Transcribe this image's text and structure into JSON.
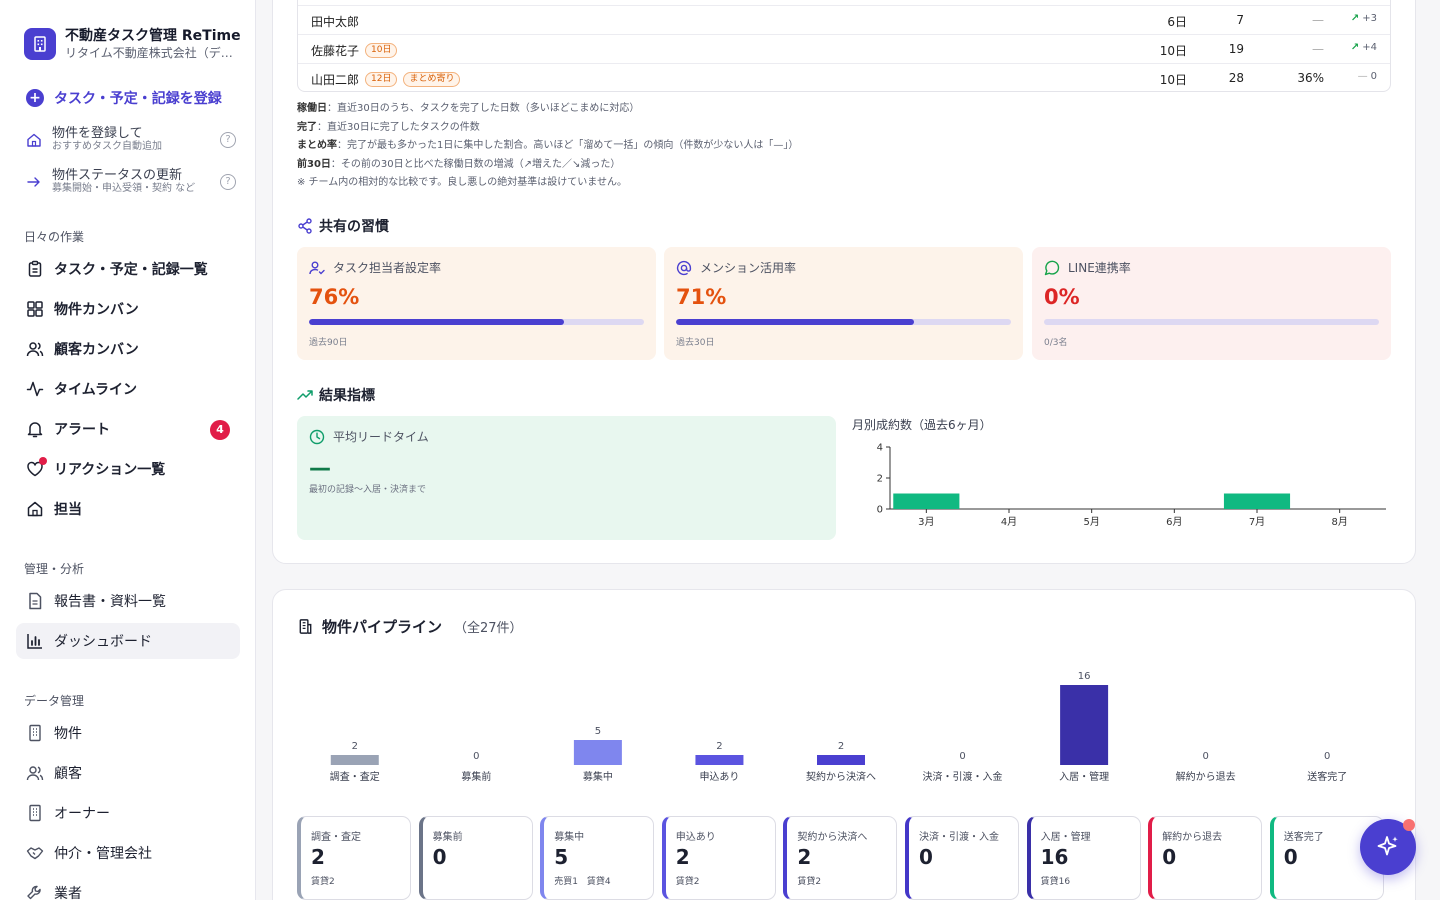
{
  "brand": {
    "title": "不動産タスク管理 ReTime",
    "subtitle": "リタイム不動産株式会社（デ…"
  },
  "sidebar": {
    "cta_label": "タスク・予定・記録を登録",
    "sub_actions": [
      {
        "title": "物件を登録して",
        "sub": "おすすめタスク自動追加",
        "help": "?"
      },
      {
        "title": "物件ステータスの更新",
        "sub": "募集開始・申込受領・契約 など",
        "help": "?"
      }
    ],
    "daily_label": "日々の作業",
    "daily_items": [
      {
        "label": "タスク・予定・記録一覧",
        "icon": "clipboard-icon"
      },
      {
        "label": "物件カンバン",
        "icon": "grid-icon"
      },
      {
        "label": "顧客カンバン",
        "icon": "users-icon"
      },
      {
        "label": "タイムライン",
        "icon": "activity-icon"
      },
      {
        "label": "アラート",
        "icon": "bell-icon",
        "badge": "4"
      },
      {
        "label": "リアクション一覧",
        "icon": "heart-icon"
      },
      {
        "label": "担当",
        "icon": "home-icon"
      }
    ],
    "admin_label": "管理・分析",
    "admin_items": [
      {
        "label": "報告書・資料一覧",
        "icon": "document-icon"
      },
      {
        "label": "ダッシュボード",
        "icon": "bar-chart-icon"
      }
    ],
    "data_label": "データ管理",
    "data_items": [
      {
        "label": "物件",
        "icon": "building-icon"
      },
      {
        "label": "顧客",
        "icon": "users-icon"
      },
      {
        "label": "オーナー",
        "icon": "building-icon"
      },
      {
        "label": "仲介・管理会社",
        "icon": "handshake-icon"
      },
      {
        "label": "業者",
        "icon": "tool-icon"
      }
    ]
  },
  "team_table": {
    "rows": [
      {
        "name": "田中太郎",
        "tags": [],
        "days": "6日",
        "done": "7",
        "ratio": "—",
        "trend_arrow": "↗",
        "trend": "+3"
      },
      {
        "name": "佐藤花子",
        "tags": [
          "10日"
        ],
        "days": "10日",
        "done": "19",
        "ratio": "—",
        "trend_arrow": "↗",
        "trend": "+4"
      },
      {
        "name": "山田二郎",
        "tags": [
          "12日",
          "まとめ寄り"
        ],
        "days": "10日",
        "done": "28",
        "ratio": "36%",
        "trend_arrow": "—",
        "trend": "0"
      }
    ]
  },
  "notes": [
    {
      "term": "稼働日",
      "text": "：直近30日のうち、タスクを完了した日数（多いほどこまめに対応）"
    },
    {
      "term": "完了",
      "text": "：直近30日に完了したタスクの件数"
    },
    {
      "term": "まとめ率",
      "text": "：完了が最も多かった1日に集中した割合。高いほど「溜めて一括」の傾向（件数が少ない人は「—」）"
    },
    {
      "term": "前30日",
      "text": "：その前の30日と比べた稼働日数の増減（↗増えた／↘減った）"
    },
    {
      "term": "",
      "text": "※ チーム内の相対的な比較です。良し悪しの絶対基準は設けていません。"
    }
  ],
  "habits": {
    "title": "共有の習慣",
    "cards": [
      {
        "label": "タスク担当者設定率",
        "value": "76%",
        "percent": 76,
        "note": "過去90日",
        "bg": "#fdf3ea",
        "val_color": "#e4520f"
      },
      {
        "label": "メンション活用率",
        "value": "71%",
        "percent": 71,
        "note": "過去30日",
        "bg": "#fdf3ea",
        "val_color": "#e4520f"
      },
      {
        "label": "LINE連携率",
        "value": "0%",
        "percent": 0,
        "note": "0/3名",
        "bg": "#fdf0ef",
        "val_color": "#dc2626"
      }
    ]
  },
  "results": {
    "title": "結果指標",
    "lead_time": {
      "label": "平均リードタイム",
      "value": "—",
      "note": "最初の記録〜入居・決済まで"
    }
  },
  "chart_data": [
    {
      "type": "bar",
      "title": "月別成約数（過去6ヶ月）",
      "categories": [
        "3月",
        "4月",
        "5月",
        "6月",
        "7月",
        "8月"
      ],
      "values": [
        1,
        0,
        0,
        0,
        1,
        0
      ],
      "ylim": [
        0,
        4
      ],
      "yticks": [
        0,
        2,
        4
      ],
      "color": "#10b981"
    },
    {
      "type": "bar",
      "title": "物件パイプライン",
      "categories": [
        "調査・査定",
        "募集前",
        "募集中",
        "申込あり",
        "契約から決済へ",
        "決済・引渡・入金",
        "入居・管理",
        "解約から退去",
        "送客完了"
      ],
      "values": [
        2,
        0,
        5,
        2,
        2,
        0,
        16,
        0,
        0
      ],
      "colors": [
        "#9aa3b5",
        "#6b7488",
        "#7f86ee",
        "#5b54e0",
        "#4a3fd0",
        "#4437c8",
        "#3a30a8",
        "#e11d48",
        "#10b981"
      ]
    }
  ],
  "pipeline": {
    "title": "物件パイプライン",
    "count": "（全27件）",
    "cards": [
      {
        "name": "調査・査定",
        "value": "2",
        "detail": "賃貸2",
        "color": "#9aa3b5"
      },
      {
        "name": "募集前",
        "value": "0",
        "detail": "",
        "color": "#6b7488"
      },
      {
        "name": "募集中",
        "value": "5",
        "detail": "売買1　賃貸4",
        "color": "#7f86ee"
      },
      {
        "name": "申込あり",
        "value": "2",
        "detail": "賃貸2",
        "color": "#5b54e0"
      },
      {
        "name": "契約から決済へ",
        "value": "2",
        "detail": "賃貸2",
        "color": "#4a3fd0"
      },
      {
        "name": "決済・引渡・入金",
        "value": "0",
        "detail": "",
        "color": "#4437c8"
      },
      {
        "name": "入居・管理",
        "value": "16",
        "detail": "賃貸16",
        "color": "#3a30a8"
      },
      {
        "name": "解約から退去",
        "value": "0",
        "detail": "",
        "color": "#e11d48"
      },
      {
        "name": "送客完了",
        "value": "0",
        "detail": "",
        "color": "#10b981"
      }
    ]
  }
}
